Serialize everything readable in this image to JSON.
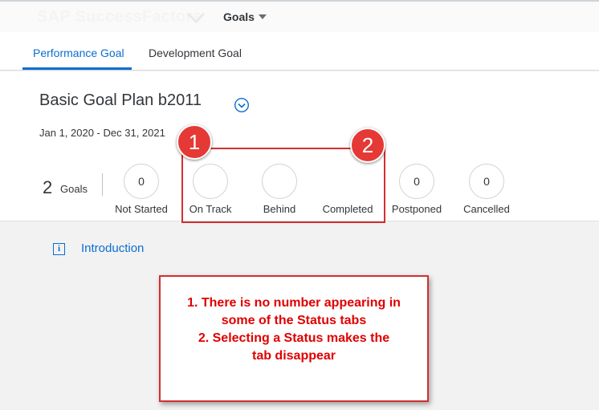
{
  "shell": {
    "brand": "SAP SuccessFactors",
    "menu_label": "Goals"
  },
  "tabs": [
    {
      "label": "Performance Goal",
      "selected": true
    },
    {
      "label": "Development Goal",
      "selected": false
    }
  ],
  "plan": {
    "title": "Basic Goal Plan b2011",
    "dates": "Jan 1, 2020 - Dec 31, 2021"
  },
  "summary": {
    "count": "2",
    "count_label": "Goals"
  },
  "statuses": [
    {
      "label": "Not Started",
      "count": "0"
    },
    {
      "label": "On Track",
      "count": ""
    },
    {
      "label": "Behind",
      "count": ""
    },
    {
      "label": "Completed",
      "count": ""
    },
    {
      "label": "Postponed",
      "count": "0"
    },
    {
      "label": "Cancelled",
      "count": "0"
    }
  ],
  "annotations": {
    "marker_1": "1",
    "marker_2": "2",
    "note_lines": [
      "1. There is no number appearing in",
      "some of the Status tabs",
      "2. Selecting a Status makes the",
      "tab disappear"
    ]
  },
  "content": {
    "intro_icon": "i",
    "intro_label": "Introduction"
  },
  "colors": {
    "accent": "#0a6ed1",
    "annotation_red": "#d32f2f",
    "note_text": "#e00000"
  },
  "icons": {
    "plan_toggle": "chevron-down-circle-icon",
    "menu_caret": "caret-down-icon",
    "intro": "info-icon"
  }
}
